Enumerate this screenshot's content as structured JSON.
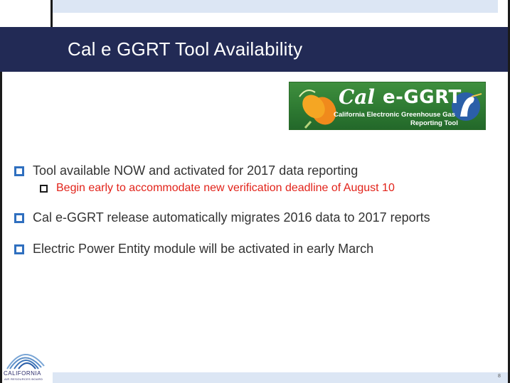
{
  "slide": {
    "title": "Cal e GGRT Tool Availability",
    "page_number": "8"
  },
  "logo": {
    "cal": "Cal",
    "ggrt": "e-GGRT",
    "line1": "California Electronic Greenhouse Gas",
    "line2": "Reporting Tool"
  },
  "bullets": [
    {
      "text": "Tool available NOW and activated for 2017 data reporting"
    },
    {
      "text": "Cal e-GGRT release automatically migrates 2016 data to 2017 reports"
    },
    {
      "text": "Electric Power Entity module will be activated in early March"
    }
  ],
  "sub_bullet": {
    "text": "Begin early to accommodate new verification deadline of August 10"
  },
  "carb": {
    "name": "CALIFORNIA",
    "subname": "AIR RESOURCES BOARD"
  },
  "colors": {
    "title_band": "#222a55",
    "bullet_marker": "#2f6fbf",
    "sub_text": "#e2231a",
    "accent_bar": "#dce6f4",
    "logo_green": "#2e7a32"
  }
}
